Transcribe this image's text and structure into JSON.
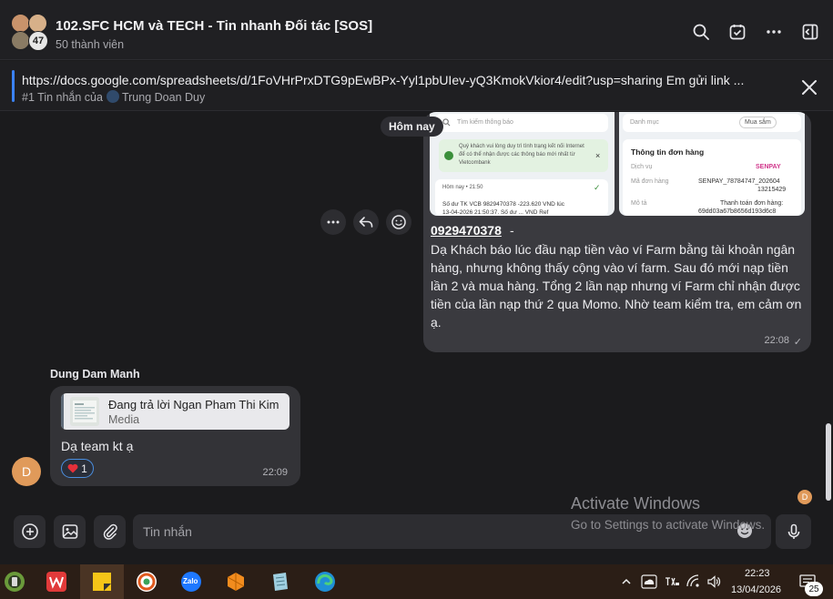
{
  "header": {
    "title": "102.SFC HCM và TECH - Tin nhanh Đối tác [SOS]",
    "members": "50 thành viên",
    "avatar_count": "47"
  },
  "pinned": {
    "text": "https://docs.google.com/spreadsheets/d/1FoVHrPrxDTG9pEwBPx-Yyl1pbUIev-yQ3KmokVkior4/edit?usp=sharing Em gửi link ...",
    "sub_prefix": "#1 Tin nhắn của",
    "sub_author": "Trung Doan Duy"
  },
  "date_divider": "Hôm nay",
  "outgoing": {
    "thumb1": {
      "search": "Tìm kiếm thông báo",
      "notice": "Quý khách vui lòng duy trì tình trạng kết nối Internet để có thể nhận được các thông báo mới nhất từ Vietcombank",
      "time": "Hôm nay • 21:50",
      "line": "Số dư TK VCB 9829470378 -223.620 VND lúc",
      "line2": "13-04-2026 21:50:37. Số dư ... VND Ref"
    },
    "thumb2": {
      "category_label": "Danh mục",
      "category_value": "Mua sắm",
      "heading": "Thông tin đơn hàng",
      "service_label": "Dịch vụ",
      "service_value": "SENPAY",
      "order_label": "Mã đơn hàng",
      "order_value": "SENPAY_78784747_202604",
      "order_value2": "13215429",
      "desc_label": "Mô tả",
      "desc_value": "Thanh toán đơn hàng:",
      "desc_value2": "69dd03a67b8656d193d6c8"
    },
    "phone": "0929470378",
    "dash": "-",
    "text": "Dạ Khách báo lúc đầu nạp tiền vào ví Farm bằng tài khoản ngân hàng, nhưng không thấy cộng vào ví farm. Sau đó mới nạp tiền lần 2 và mua hàng. Tổng 2 lần nạp nhưng ví Farm chỉ nhận được tiền của lần nạp thứ 2 qua Momo. Nhờ team kiểm tra, em cảm ơn ạ.",
    "time": "22:08"
  },
  "incoming": {
    "sender": "Dung Dam Manh",
    "avatar_letter": "D",
    "reply_title": "Đang trả lời Ngan Pham Thi Kim",
    "reply_type": "Media",
    "text": "Dạ team kt ạ",
    "reaction_count": "1",
    "time": "22:09"
  },
  "scroll_badge": "D",
  "watermark": {
    "line1": "Activate Windows",
    "line2": "Go to Settings to activate Windows."
  },
  "composer": {
    "placeholder": "Tin nhắn"
  },
  "taskbar": {
    "time": "22:23",
    "date": "13/04/2026",
    "notifications": "25",
    "zalo_label": "Zalo"
  },
  "colors": {
    "accent": "#3b82f6",
    "bubble_out": "#3a3a3f",
    "bubble_in": "#333337",
    "taskbar": "#2b1e16"
  }
}
